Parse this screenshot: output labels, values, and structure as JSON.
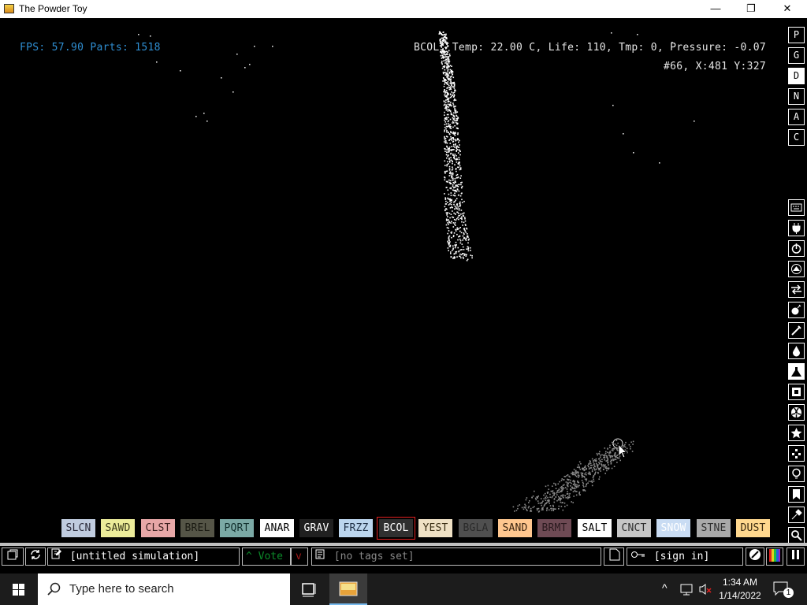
{
  "window": {
    "title": "The Powder Toy",
    "minimize": "—",
    "maximize": "❐",
    "close": "✕"
  },
  "hud": {
    "fps_label": "FPS: 57.90 Parts: 1518",
    "particle_info": "BCOL, Temp: 22.00 C, Life: 110, Tmp: 0, Pressure: -0.07",
    "position_info": "#66, X:481 Y:327"
  },
  "right_buttons": [
    "P",
    "G",
    "D",
    "N",
    "A",
    "C"
  ],
  "elements": [
    {
      "label": "SLCN",
      "bg": "#c0ccdf",
      "fg": "#2a2a3a"
    },
    {
      "label": "SAWD",
      "bg": "#ecec9a",
      "fg": "#3a3a1a"
    },
    {
      "label": "CLST",
      "bg": "#e7a7a7",
      "fg": "#3a1e1e"
    },
    {
      "label": "BREL",
      "bg": "#555547",
      "fg": "#1a1a12"
    },
    {
      "label": "PQRT",
      "bg": "#7ba9a5",
      "fg": "#12302e"
    },
    {
      "label": "ANAR",
      "bg": "#ffffff",
      "fg": "#000000"
    },
    {
      "label": "GRAV",
      "bg": "#202020",
      "fg": "#ffffff"
    },
    {
      "label": "FRZZ",
      "bg": "#bcd6ee",
      "fg": "#1e2f44"
    },
    {
      "label": "BCOL",
      "bg": "#303030",
      "fg": "#ffffff",
      "selected": true
    },
    {
      "label": "YEST",
      "bg": "#efe1c5",
      "fg": "#3a2e14"
    },
    {
      "label": "BGLA",
      "bg": "#4f4f4f",
      "fg": "#2a2a2a"
    },
    {
      "label": "SAND",
      "bg": "#ffc78f",
      "fg": "#3a2410"
    },
    {
      "label": "BRMT",
      "bg": "#6e4a54",
      "fg": "#2b1a1f"
    },
    {
      "label": "SALT",
      "bg": "#ffffff",
      "fg": "#000000"
    },
    {
      "label": "CNCT",
      "bg": "#c6c6c6",
      "fg": "#2e2e2e"
    },
    {
      "label": "SNOW",
      "bg": "#c9dcf3",
      "fg": "#ffffff"
    },
    {
      "label": "STNE",
      "bg": "#a9a9a9",
      "fg": "#2e2e2e"
    },
    {
      "label": "DUST",
      "bg": "#ffd88e",
      "fg": "#3a2a10"
    }
  ],
  "bottom": {
    "sim_name": "[untitled simulation]",
    "vote": "Vote",
    "tags": "[no tags set]",
    "sign_in": "[sign in]"
  },
  "taskbar": {
    "search_placeholder": "Type here to search",
    "time": "1:34 AM",
    "date": "1/14/2022",
    "notifications": "1"
  },
  "colors": {
    "fps_text": "#2f8fd3",
    "info_text": "#e6e6e6",
    "selected_outline": "#e02020",
    "vote_green": "#0c8a2a",
    "vote_red": "#a01818"
  }
}
